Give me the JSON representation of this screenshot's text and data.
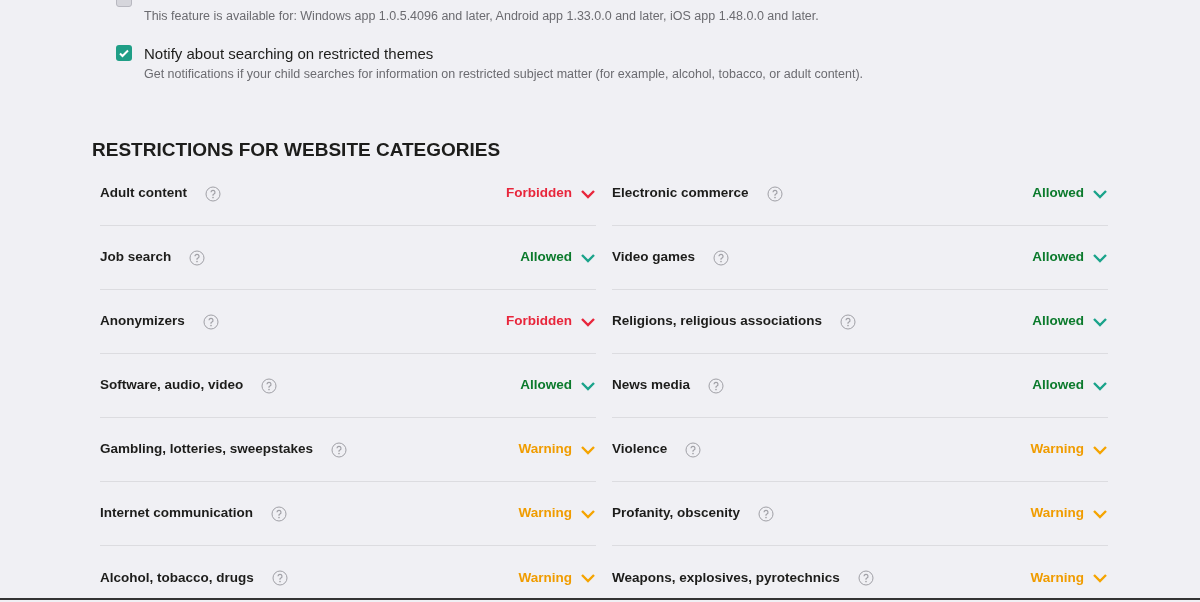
{
  "options": [
    {
      "checked": false,
      "description": "This feature is available for: Windows app 1.0.5.4096 and later, Android app 1.33.0.0 and later, iOS app 1.48.0.0 and later."
    },
    {
      "checked": true,
      "label": "Notify about searching on restricted themes",
      "description": "Get notifications if your child searches for information on restricted subject matter (for example, alcohol, tobacco, or adult content)."
    }
  ],
  "section_title": "RESTRICTIONS FOR WEBSITE CATEGORIES",
  "categories": [
    {
      "name": "Adult content",
      "status": "Forbidden",
      "kind": "forbidden"
    },
    {
      "name": "Electronic commerce",
      "status": "Allowed",
      "kind": "allowed"
    },
    {
      "name": "Job search",
      "status": "Allowed",
      "kind": "allowed"
    },
    {
      "name": "Video games",
      "status": "Allowed",
      "kind": "allowed"
    },
    {
      "name": "Anonymizers",
      "status": "Forbidden",
      "kind": "forbidden"
    },
    {
      "name": "Religions, religious associations",
      "status": "Allowed",
      "kind": "allowed"
    },
    {
      "name": "Software, audio, video",
      "status": "Allowed",
      "kind": "allowed"
    },
    {
      "name": "News media",
      "status": "Allowed",
      "kind": "allowed"
    },
    {
      "name": "Gambling, lotteries, sweepstakes",
      "status": "Warning",
      "kind": "warning"
    },
    {
      "name": "Violence",
      "status": "Warning",
      "kind": "warning"
    },
    {
      "name": "Internet communication",
      "status": "Warning",
      "kind": "warning"
    },
    {
      "name": "Profanity, obscenity",
      "status": "Warning",
      "kind": "warning"
    },
    {
      "name": "Alcohol, tobacco, drugs",
      "status": "Warning",
      "kind": "warning"
    },
    {
      "name": "Weapons, explosives, pyrotechnics",
      "status": "Warning",
      "kind": "warning"
    }
  ]
}
